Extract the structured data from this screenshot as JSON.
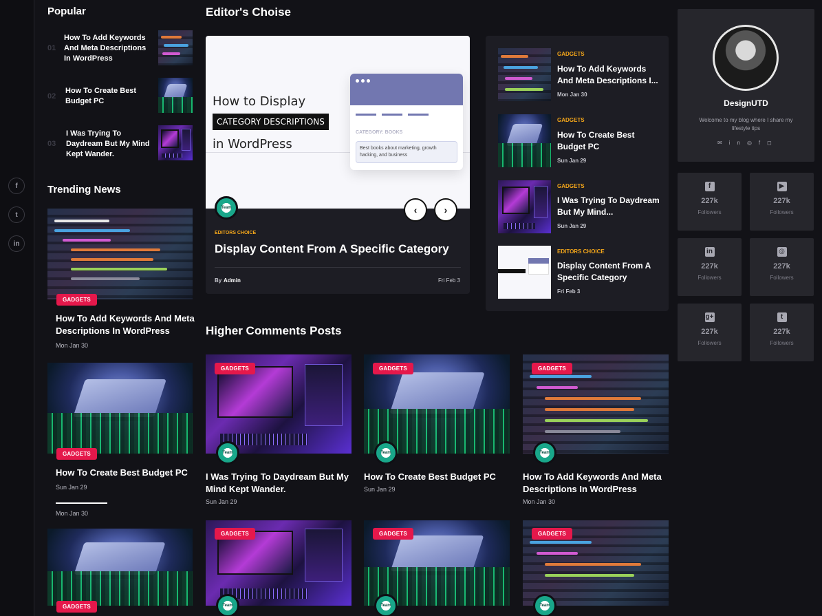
{
  "social_rail": [
    "f",
    "t",
    "in"
  ],
  "popular": {
    "heading": "Popular",
    "items": [
      {
        "num": "01",
        "title": "How To Add Keywords And Meta Descriptions In WordPress"
      },
      {
        "num": "02",
        "title": "How To Create Best Budget PC"
      },
      {
        "num": "03",
        "title": "I Was Trying To Daydream But My Mind Kept Wander."
      }
    ]
  },
  "trending": {
    "heading": "Trending News",
    "items": [
      {
        "badge": "GADGETS",
        "title": "How To Add Keywords And Meta Descriptions In WordPress",
        "date": "Mon Jan 30"
      },
      {
        "badge": "GADGETS",
        "title": "How To Create Best Budget PC",
        "date": "Sun Jan 29"
      },
      {
        "date_extra": "Mon Jan 30"
      },
      {
        "badge": "GADGETS"
      }
    ]
  },
  "editors": {
    "heading": "Editor's Choise",
    "slide": {
      "image_line1": "How to Display",
      "image_highlight": "CATEGORY DESCRIPTIONS",
      "image_line3": "in WordPress",
      "mock_category": "CATEGORY: BOOKS",
      "mock_text": "Best books about marketing, growth hacking, and business",
      "category": "EDITORS CHOICE",
      "title": "Display Content From A Specific Category",
      "by": "By",
      "author": "Admin",
      "date": "Fri Feb 3",
      "prev": "‹",
      "next": "›"
    },
    "list": [
      {
        "cat": "GADGETS",
        "title": "How To Add Keywords And Meta Descriptions I...",
        "date": "Mon Jan 30"
      },
      {
        "cat": "GADGETS",
        "title": "How To Create Best Budget PC",
        "date": "Sun Jan 29"
      },
      {
        "cat": "GADGETS",
        "title": "I Was Trying To Daydream But My Mind...",
        "date": "Sun Jan 29"
      },
      {
        "cat": "EDITORS CHOICE",
        "title": "Display Content From A Specific Category",
        "date": "Fri Feb 3"
      }
    ]
  },
  "higher_comments": {
    "heading": "Higher Comments Posts",
    "posts": [
      {
        "badge": "GADGETS",
        "title": "I Was Trying To Daydream But My Mind Kept Wander.",
        "date": "Sun Jan 29"
      },
      {
        "badge": "GADGETS",
        "title": "How To Create Best Budget PC",
        "date": "Sun Jan 29"
      },
      {
        "badge": "GADGETS",
        "title": "How To Add Keywords And Meta Descriptions In WordPress",
        "date": "Mon Jan 30"
      }
    ],
    "row2_badges": [
      "GADGETS",
      "GADGETS",
      "GADGETS"
    ]
  },
  "avatar_label": "Team",
  "profile": {
    "name": "DesignUTD",
    "bio": "Welcome to my blog where I share my lifestyle tips"
  },
  "stats": [
    {
      "icon": "facebook-icon",
      "glyph": "f",
      "num": "227k",
      "label": "Followers"
    },
    {
      "icon": "youtube-icon",
      "glyph": "▶",
      "num": "227k",
      "label": "Followers"
    },
    {
      "icon": "linkedin-icon",
      "glyph": "in",
      "num": "227k",
      "label": "Followers"
    },
    {
      "icon": "instagram-icon",
      "glyph": "◎",
      "num": "227k",
      "label": "Followers"
    },
    {
      "icon": "google-plus-icon",
      "glyph": "g+",
      "num": "227k",
      "label": "Followers"
    },
    {
      "icon": "twitter-icon",
      "glyph": "t",
      "num": "227k",
      "label": "Followers"
    }
  ],
  "colors": {
    "badge": "#e5184b",
    "category_accent": "#f2a51a",
    "background": "#121217",
    "card": "#1d1d24"
  }
}
